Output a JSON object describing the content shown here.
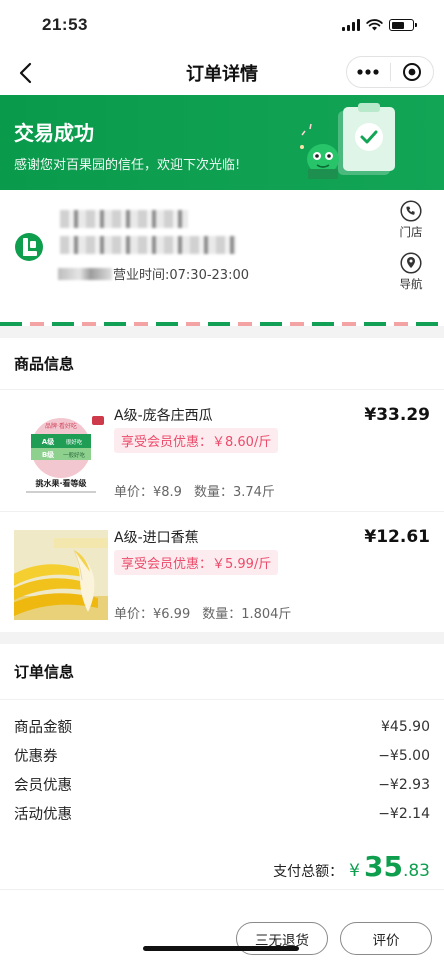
{
  "status_bar": {
    "time": "21:53"
  },
  "nav": {
    "title": "订单详情"
  },
  "banner": {
    "title": "交易成功",
    "subtitle": "感谢您对百果园的信任，欢迎下次光临!"
  },
  "store": {
    "hours": "营业时间:07:30-23:00",
    "actions": [
      "门店",
      "导航"
    ]
  },
  "goods_section": {
    "title": "商品信息",
    "items": [
      {
        "name": "A级-庞各庄西瓜",
        "price": "¥33.29",
        "discount": "享受会员优惠：￥8.60/斤",
        "unit_price": "单价：¥8.9",
        "quantity": "数量：3.74斤",
        "image_text": {
          "top": "品牌·看好吃",
          "mid": "A级",
          "mid_sub": "很好吃",
          "low": "B级",
          "low_sub": "一般好吃",
          "footer": "挑水果·看等级"
        }
      },
      {
        "name": "A级-进口香蕉",
        "price": "¥12.61",
        "discount": "享受会员优惠：￥5.99/斤",
        "unit_price": "单价：¥6.99",
        "quantity": "数量：1.804斤"
      }
    ]
  },
  "order_section": {
    "title": "订单信息",
    "rows": [
      {
        "label": "商品金额",
        "value": "¥45.90"
      },
      {
        "label": "优惠券",
        "value": "−¥5.00"
      },
      {
        "label": "会员优惠",
        "value": "−¥2.93"
      },
      {
        "label": "活动优惠",
        "value": "−¥2.14"
      }
    ],
    "total_label": "支付总额：",
    "total_currency": "¥",
    "total_int": "35",
    "total_dec": ".83"
  },
  "bottom_buttons": [
    "三无退货",
    "评价"
  ],
  "colors": {
    "brand_green": "#0e9e4e",
    "discount_pink": "#ec4b6b"
  },
  "icons": [
    "back-icon",
    "more-icon",
    "capsule-close-icon",
    "phone-icon",
    "location-icon",
    "store-logo-icon"
  ]
}
